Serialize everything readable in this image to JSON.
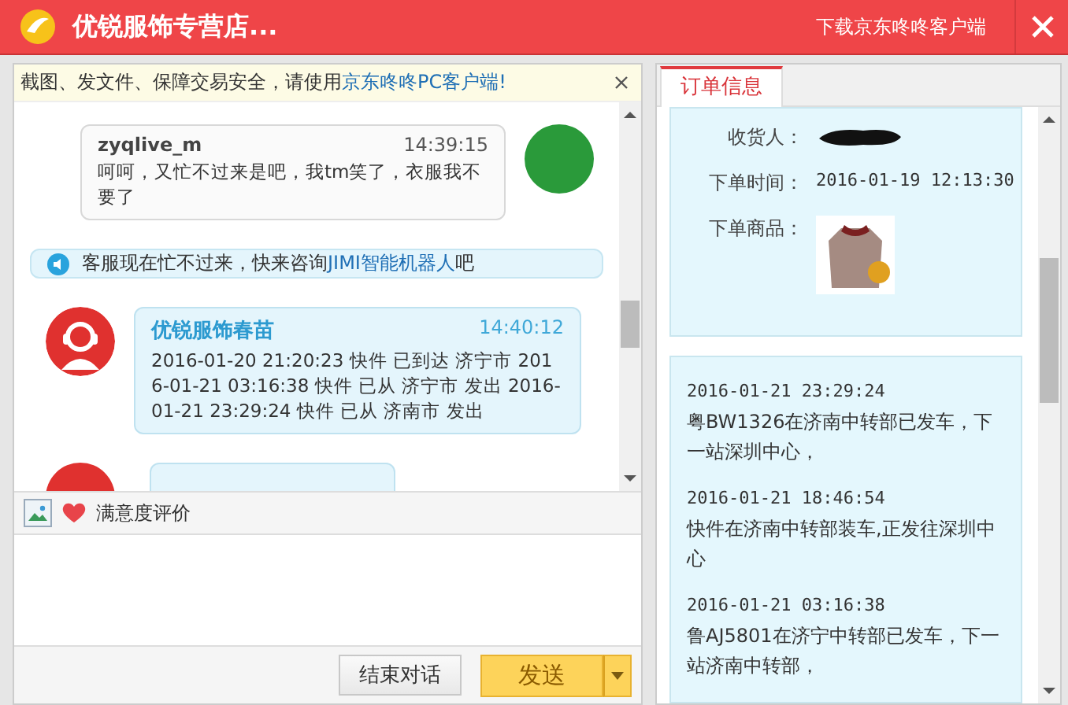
{
  "window": {
    "title": "优锐服饰专营店...",
    "download_link": "下载京东咚咚客户端"
  },
  "notice": {
    "text": "截图、发文件、保障交易安全，请使用",
    "link": "京东咚咚PC客户端!"
  },
  "messages": [
    {
      "kind": "outgoing",
      "sender": "zyqlive_m",
      "time": "14:39:15",
      "text": "呵呵，又忙不过来是吧，我tm笑了，衣服我不要了"
    },
    {
      "kind": "system",
      "text": "客服现在忙不过来，快来咨询",
      "link": "JIMI智能机器人",
      "suffix": "吧"
    },
    {
      "kind": "incoming",
      "sender": "优锐服饰春苗",
      "time": "14:40:12",
      "text": "2016-01-20 21:20:23 快件 已到达 济宁市 2016-01-21 03:16:38 快件 已从 济宁市 发出 2016-01-21 23:29:24 快件 已从 济南市 发出"
    },
    {
      "kind": "cut_off"
    }
  ],
  "toolbar": {
    "rating_label": "满意度评价"
  },
  "buttons": {
    "end": "结束对话",
    "send": "发送"
  },
  "order_panel": {
    "tabs": [
      {
        "label": "订单信息",
        "selected": true
      }
    ],
    "fields": [
      {
        "kind": "redacted",
        "label": "收货人："
      },
      {
        "kind": "text",
        "label": "下单时间：",
        "value": "2016-01-19 12:13:30"
      },
      {
        "kind": "image",
        "label": "下单商品："
      }
    ],
    "tracking": [
      {
        "time": "2016-01-21 23:29:24",
        "text": "粤BW1326在济南中转部已发车，下一站深圳中心，"
      },
      {
        "time": "2016-01-21 18:46:54",
        "text": "快件在济南中转部装车,正发往深圳中心"
      },
      {
        "time": "2016-01-21 03:16:38",
        "text": "鲁AJ5801在济宁中转部已发车，下一站济南中转部，"
      }
    ]
  }
}
